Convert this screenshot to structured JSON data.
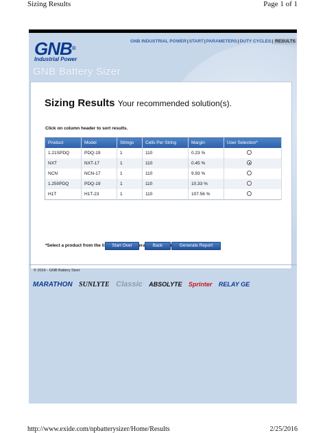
{
  "print": {
    "header_left": "Sizing Results",
    "header_right": "Page 1 of 1",
    "footer_left": "http://www.exide.com/npbatterysizer/Home/Results",
    "footer_right": "2/25/2016"
  },
  "brand": {
    "logo_text": "GNB",
    "logo_reg": "®",
    "logo_sub": "Industrial Power",
    "app_title": "GNB Battery Sizer",
    "primary_color": "#0b3b8f"
  },
  "nav": {
    "items": [
      "GNB INDUSTRIAL POWER",
      "START",
      "PARAMETERS",
      "DUTY CYCLES",
      "RESULTS"
    ],
    "separator": "|",
    "active": "RESULTS"
  },
  "main": {
    "heading_bold": "Sizing Results",
    "heading_sub": "Your recommended solution(s).",
    "hint": "Click on column header to sort results.",
    "table": {
      "columns": [
        "Product",
        "Model",
        "Strings",
        "Cells Per String",
        "Margin",
        "User Selection*"
      ],
      "rows": [
        {
          "product": "1.21SPDQ",
          "model": "PDQ-19",
          "strings": "1",
          "cells": "110",
          "margin": "0.23 %",
          "selected": false
        },
        {
          "product": "NXT",
          "model": "NXT-17",
          "strings": "1",
          "cells": "110",
          "margin": "0.45 %",
          "selected": true
        },
        {
          "product": "NCN",
          "model": "NCN-17",
          "strings": "1",
          "cells": "110",
          "margin": "9.93 %",
          "selected": false
        },
        {
          "product": "1.250PDQ",
          "model": "PDQ-19",
          "strings": "1",
          "cells": "110",
          "margin": "10.33 %",
          "selected": false
        },
        {
          "product": "H1T",
          "model": "H1T-23",
          "strings": "1",
          "cells": "110",
          "margin": "107.56 %",
          "selected": false
        }
      ],
      "header_color": "#2c5fa8"
    },
    "note": "*Select a product from the list and click Generate Report for .pdf report.",
    "buttons": {
      "start_over": "Start Over",
      "back": "Back",
      "generate": "Generate Report"
    }
  },
  "footer": {
    "copyright": "© 2016 - GNB Battery Sizer",
    "brands": [
      "MARATHON",
      "SUNLYTE",
      "Classic",
      "ABSOLYTE",
      "Sprinter",
      "RELAY GE"
    ]
  }
}
